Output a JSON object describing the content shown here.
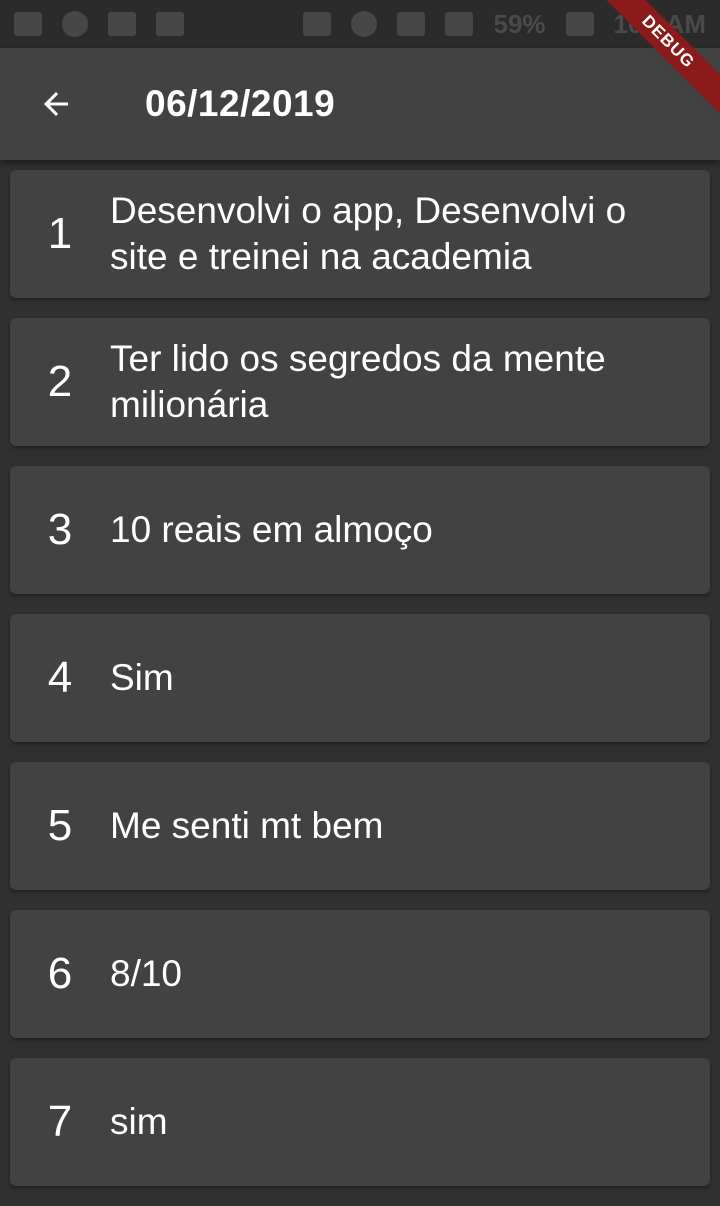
{
  "status_bar": {
    "battery": "59%",
    "time": "10:..AM"
  },
  "debug_banner": "DEBUG",
  "app_bar": {
    "back_icon": "arrow-back-icon",
    "title": "06/12/2019"
  },
  "items": [
    {
      "number": "1",
      "text": "Desenvolvi o app, Desenvolvi o site e treinei na academia"
    },
    {
      "number": "2",
      "text": "Ter lido os segredos da mente milionária"
    },
    {
      "number": "3",
      "text": "10 reais em almoço"
    },
    {
      "number": "4",
      "text": "Sim"
    },
    {
      "number": "5",
      "text": "Me senti mt bem"
    },
    {
      "number": "6",
      "text": "8/10"
    },
    {
      "number": "7",
      "text": "sim"
    }
  ]
}
